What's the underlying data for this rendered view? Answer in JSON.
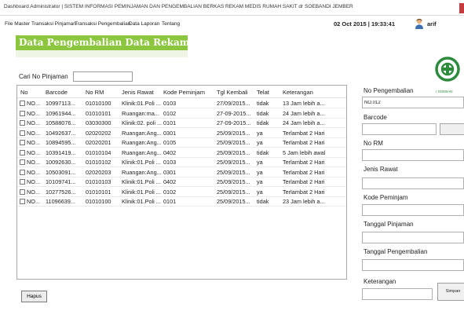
{
  "window": {
    "title": "Dashboard Administrator | SISTEM INFORMASI PEMINJAMAN DAN PENGEMBALIAN BERKAS REKAM MEDIS RUMAH SAKIT dr SOEBANDI JEMBER"
  },
  "menu": {
    "items": [
      "File Master",
      "Transaksi Pinjaman",
      "Transaksi Pengembalian",
      "Data Laporan",
      "Tentang"
    ],
    "datetime": "02 Oct 2015 | 19:33:41",
    "user": "arif"
  },
  "page": {
    "title": "Data Pengembalian Data Rekam Medis",
    "logo_caption": "r SOEBAN"
  },
  "search": {
    "label": "Cari No Pinjaman",
    "value": ""
  },
  "table": {
    "columns": [
      "No",
      "Barcode",
      "No RM",
      "Jenis Rawat",
      "Kode Peminjam",
      "Tgl Kembali",
      "Telat",
      "Keterangan"
    ],
    "rows": [
      [
        "NO...",
        "10997113...",
        "01010100",
        "Klinik:01.Poli ...",
        "0103",
        "27/09/2015...",
        "tidak",
        "13 Jam lebih a..."
      ],
      [
        "NO...",
        "10961944...",
        "01010101",
        "Ruangan:ma...",
        "0102",
        "27-09-2015...",
        "tidak",
        "24 Jam lebih a..."
      ],
      [
        "NO...",
        "10588076...",
        "03030300",
        "Klinik:02. poli ...",
        "0101",
        "27-09-2015...",
        "tidak",
        "24 Jam lebih a..."
      ],
      [
        "NO...",
        "10492637...",
        "02020202",
        "Ruangan:Ang...",
        "0301",
        "25/09/2015...",
        "ya",
        "Terlambat 2 Hari"
      ],
      [
        "NO...",
        "10894595...",
        "02020201",
        "Ruangan:Ang...",
        "0105",
        "25/09/2015...",
        "ya",
        "Terlambat 2 Hari"
      ],
      [
        "NO...",
        "10391419...",
        "01010104",
        "Ruangan:Ang...",
        "0402",
        "25/09/2015...",
        "tidak",
        "5 Jam lebih awal"
      ],
      [
        "NO...",
        "10092630...",
        "01010102",
        "Klinik:01.Poli ...",
        "0103",
        "25/09/2015...",
        "ya",
        "Terlambat 2 Hari"
      ],
      [
        "NO...",
        "10503091...",
        "02020203",
        "Ruangan:Ang...",
        "0301",
        "25/09/2015...",
        "ya",
        "Terlambat 2 Hari"
      ],
      [
        "NO...",
        "10109741...",
        "01010103",
        "Klinik:01.Poli ...",
        "0402",
        "25/09/2015...",
        "ya",
        "Terlambat 2 Hari"
      ],
      [
        "NO...",
        "10277526...",
        "01010101",
        "Klinik:01.Poli ...",
        "0102",
        "25/09/2015...",
        "ya",
        "Terlambat 2 Hari"
      ],
      [
        "NO...",
        "11096639...",
        "01010100",
        "Klinik:01.Poli ...",
        "0101",
        "25/09/2015...",
        "tidak",
        "23 Jam lebih a..."
      ]
    ]
  },
  "form": {
    "labels": {
      "no_pengembalian": "No Pengembalian",
      "barcode": "Barcode",
      "no_rm": "No RM",
      "jenis_rawat": "Jenis Rawat",
      "kode_peminjam": "Kode Peminjam",
      "tanggal_pinjaman": "Tanggal Pinjaman",
      "tanggal_pengembalian": "Tanggal Pengembalian",
      "keterangan": "Keterangan"
    },
    "values": {
      "no_pengembalian": "NO.012"
    },
    "save_label": "Simpan"
  },
  "buttons": {
    "hapus": "Hapus"
  },
  "colors": {
    "accent_green": "#8cc63f",
    "close_red": "#c43c3c"
  }
}
